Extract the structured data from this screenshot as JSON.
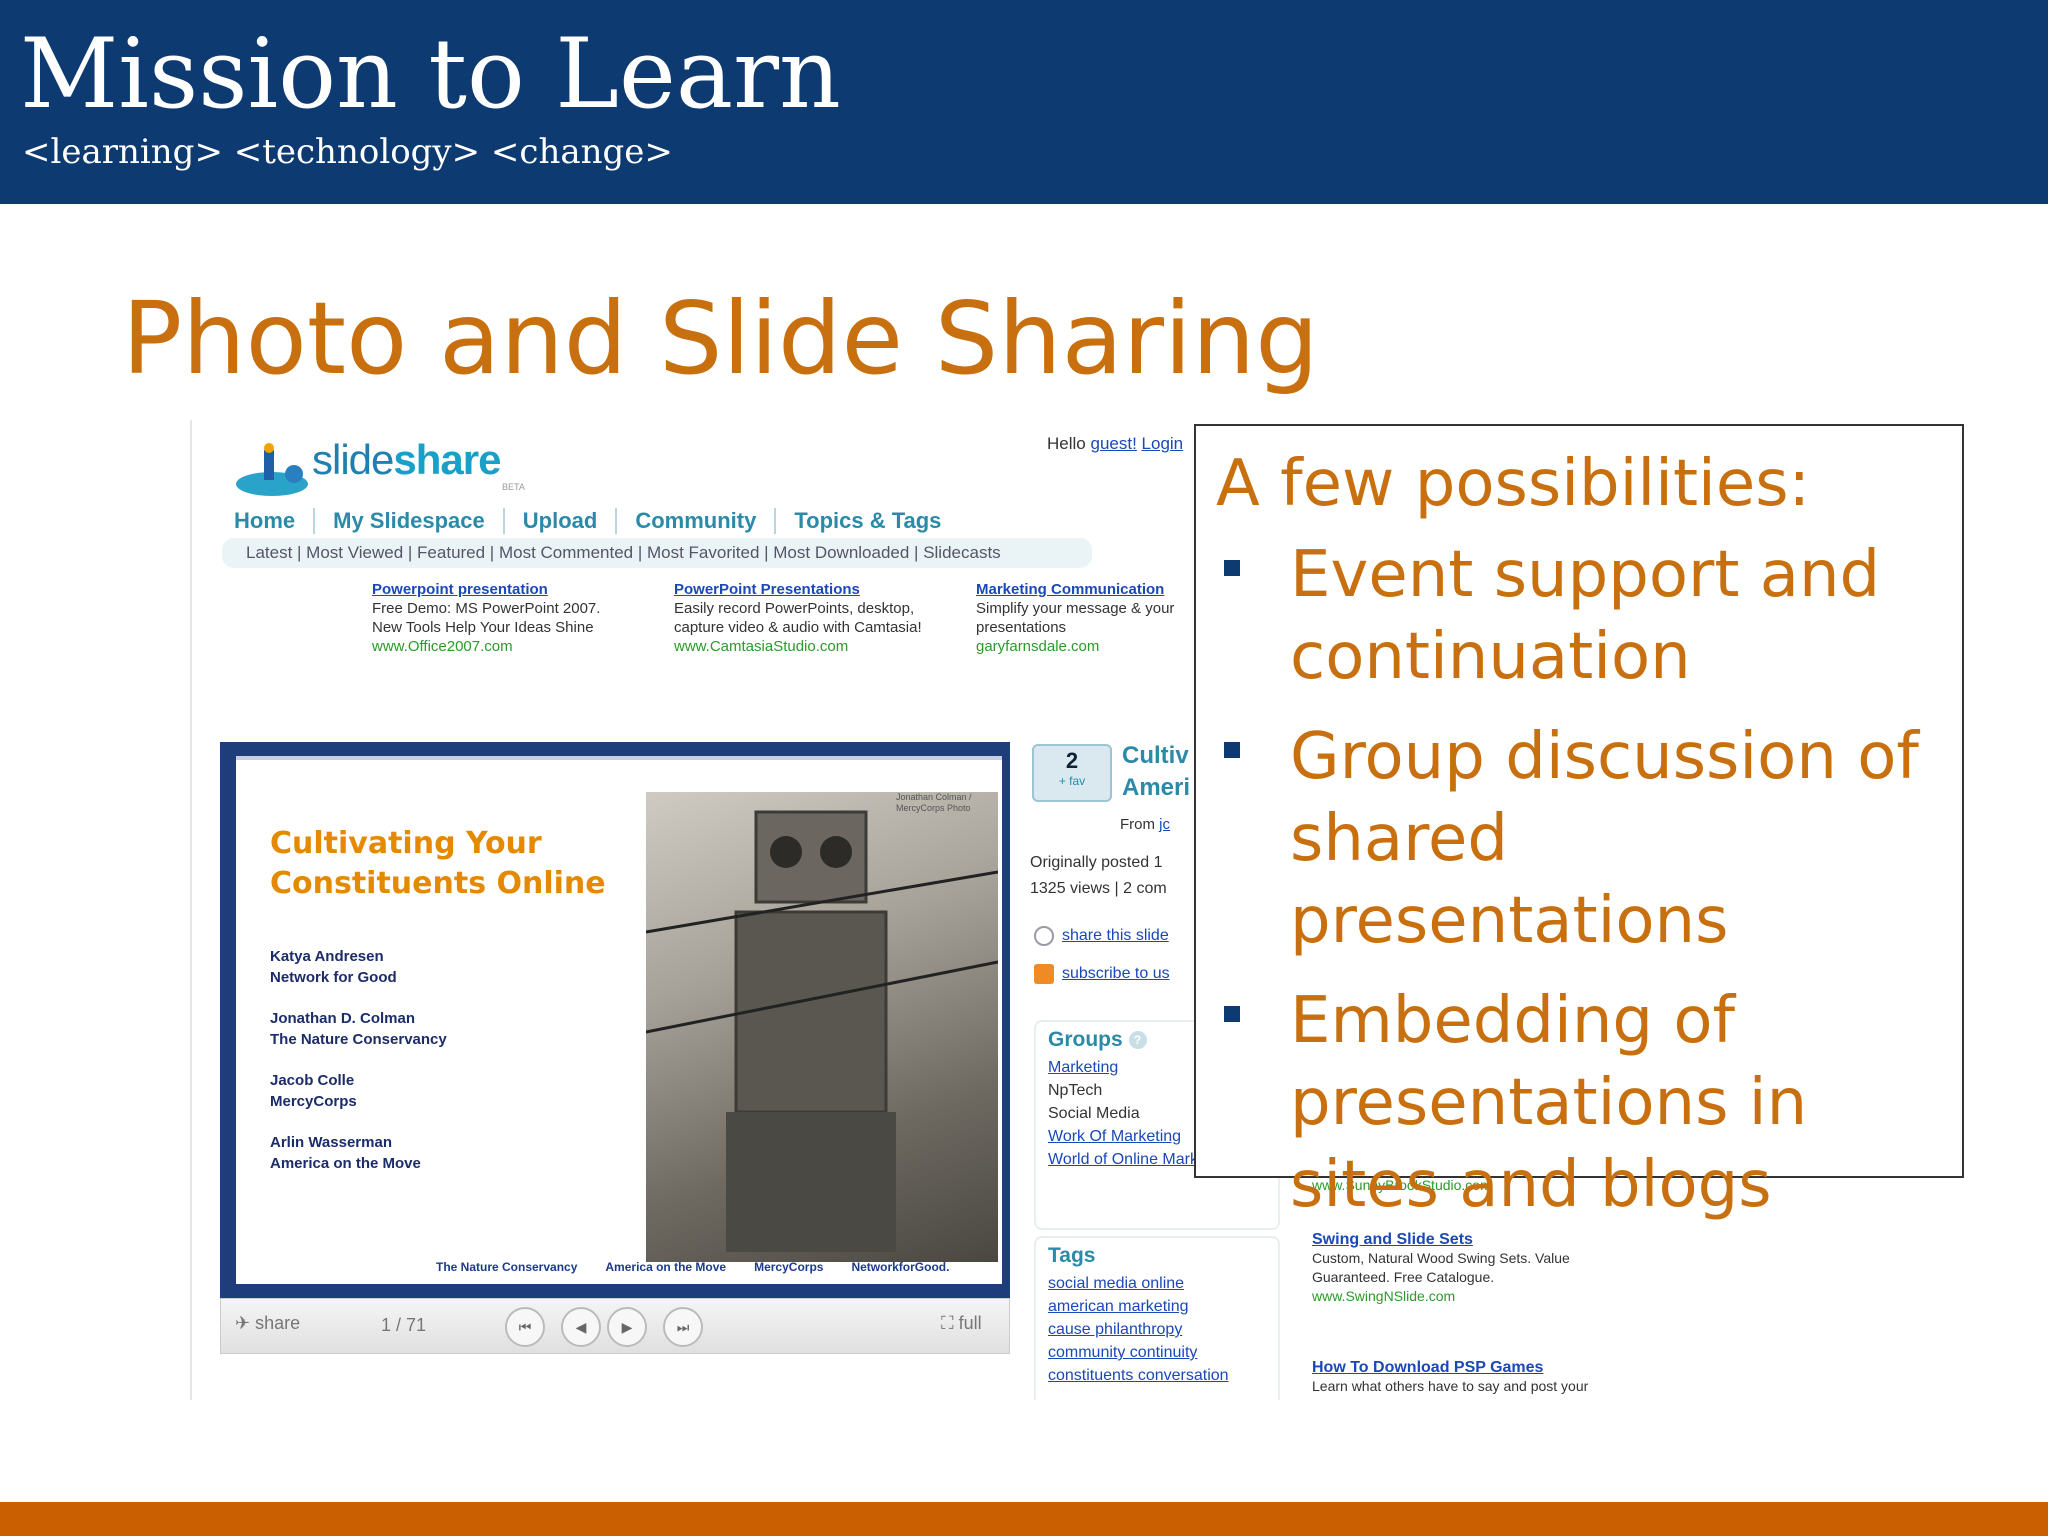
{
  "slide": {
    "header_title": "Mission to Learn",
    "header_subtitle": "<learning> <technology> <change>",
    "title": "Photo and Slide Sharing",
    "colors": {
      "header": "#0d3a70",
      "accent": "#c8700f",
      "footer": "#c95f00"
    }
  },
  "screenshot": {
    "logo_text_light": "slide",
    "logo_text_bold": "share",
    "logo_beta": "BETA",
    "hello_text": "Hello",
    "hello_user": "guest!",
    "hello_login": "Login",
    "nav": [
      "Home",
      "My Slidespace",
      "Upload",
      "Community",
      "Topics & Tags"
    ],
    "subnav": "Latest | Most Viewed | Featured | Most Commented | Most Favorited | Most Downloaded | Slidecasts",
    "ads": [
      {
        "title": "Powerpoint presentation",
        "body": "Free Demo: MS PowerPoint 2007. New Tools Help Your Ideas Shine",
        "url": "www.Office2007.com"
      },
      {
        "title": "PowerPoint Presentations",
        "body": "Easily record PowerPoints, desktop, capture video & audio with Camtasia!",
        "url": "www.CamtasiaStudio.com"
      },
      {
        "title": "Marketing Communication",
        "body": "Simplify your message & your presentations",
        "url": "garyfarnsdale.com"
      }
    ],
    "presentation": {
      "title_line1": "Cultivating Your",
      "title_line2": "Constituents Online",
      "authors": [
        {
          "name": "Katya Andresen",
          "org": "Network for Good"
        },
        {
          "name": "Jonathan D. Colman",
          "org": "The Nature Conservancy"
        },
        {
          "name": "Jacob Colle",
          "org": "MercyCorps"
        },
        {
          "name": "Arlin Wasserman",
          "org": "America on the Move"
        }
      ],
      "photo_credit": "Jonathan Colman / MercyCorps Photo",
      "logos": [
        "The Nature Conservancy",
        "America on the Move",
        "MercyCorps",
        "NetworkforGood."
      ]
    },
    "controls": {
      "share": "share",
      "page": "1 / 71",
      "full": "full"
    },
    "side": {
      "favorites_count": "2",
      "favorites_label": "+ fav",
      "title_line1": "Cultiv",
      "title_line2": "Ameri",
      "from_label": "From",
      "from_user": "jc",
      "meta_line1": "Originally posted 1",
      "meta_line2": "1325 views | 2 com",
      "share_link": "share this slide",
      "subscribe_link": "subscribe to us"
    },
    "groups": {
      "title": "Groups",
      "help": "?",
      "items": [
        "Marketing",
        "NpTech",
        "Social Media",
        "Work Of Marketing",
        "World of Online Marketing"
      ]
    },
    "tags": {
      "title": "Tags",
      "items": [
        "social media  online",
        "american marketing",
        "cause  philanthropy",
        "community  continuity",
        "constituents  conversation"
      ]
    },
    "right_ads": [
      {
        "title": "",
        "body": "",
        "url": "www.SunnyBrookStudio.com"
      },
      {
        "title": "Swing and Slide Sets",
        "body": "Custom, Natural Wood Swing Sets. Value",
        "body2": "Guaranteed. Free Catalogue.",
        "url": "www.SwingNSlide.com"
      },
      {
        "title": "How To Download PSP Games",
        "body": "Learn what others have to say and post your",
        "url": ""
      }
    ]
  },
  "callout": {
    "heading": "A few possibilities:",
    "bullets": [
      "Event support and continuation",
      "Group discussion of shared presentations",
      "Embedding of presentations in sites and blogs"
    ]
  }
}
